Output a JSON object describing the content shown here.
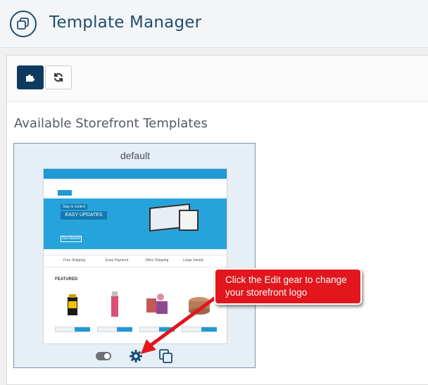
{
  "header": {
    "title": "Template Manager",
    "icon": "templates-icon"
  },
  "toolbar": {
    "buttons": [
      {
        "icon": "puzzle-icon"
      },
      {
        "icon": "refresh-icon"
      }
    ]
  },
  "main": {
    "section_title": "Available Storefront Templates",
    "templates": [
      {
        "name": "default",
        "preview": {
          "banner_kicker": "Stay in control",
          "banner_title": "EASY UPDATES",
          "banner_cta": "Get Started",
          "featured_label": "FEATURED",
          "features": [
            "Free Shipping",
            "Easy Payment",
            "24hrs Shipping",
            "Large Variety"
          ]
        },
        "actions": [
          "toggle-switch",
          "gear-icon",
          "copy-icon"
        ]
      }
    ]
  },
  "annotation": {
    "callout_text": "Click the Edit gear to change your storefront logo",
    "color": "#e2161c"
  },
  "colors": {
    "header_text": "#1f4e6e",
    "primary_button": "#0f3a5f",
    "card_bg": "#e6eef6"
  }
}
